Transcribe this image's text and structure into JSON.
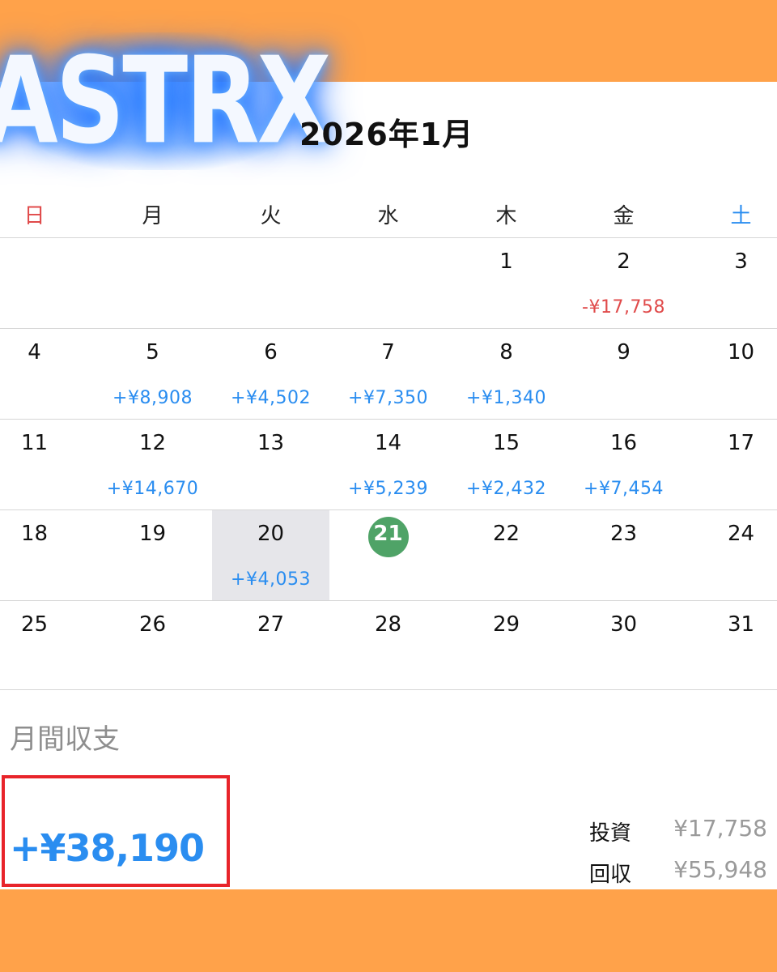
{
  "colors": {
    "banner": "#FFA24A",
    "positive": "#2a8df0",
    "negative": "#e04a4a",
    "today": "#4fa367",
    "highlight_box": "#e8242a"
  },
  "logo_text": "ASTRX",
  "header": {
    "title": "2026年1月"
  },
  "weekdays": [
    "日",
    "月",
    "火",
    "水",
    "木",
    "金",
    "土"
  ],
  "weeks": [
    [
      {
        "day": "",
        "amount": ""
      },
      {
        "day": "",
        "amount": ""
      },
      {
        "day": "",
        "amount": ""
      },
      {
        "day": "",
        "amount": ""
      },
      {
        "day": "1",
        "amount": ""
      },
      {
        "day": "2",
        "amount": "-¥17,758",
        "negative": true
      },
      {
        "day": "3",
        "amount": ""
      }
    ],
    [
      {
        "day": "4",
        "amount": ""
      },
      {
        "day": "5",
        "amount": "+¥8,908"
      },
      {
        "day": "6",
        "amount": "+¥4,502"
      },
      {
        "day": "7",
        "amount": "+¥7,350"
      },
      {
        "day": "8",
        "amount": "+¥1,340"
      },
      {
        "day": "9",
        "amount": ""
      },
      {
        "day": "10",
        "amount": ""
      }
    ],
    [
      {
        "day": "11",
        "amount": ""
      },
      {
        "day": "12",
        "amount": "+¥14,670"
      },
      {
        "day": "13",
        "amount": ""
      },
      {
        "day": "14",
        "amount": "+¥5,239"
      },
      {
        "day": "15",
        "amount": "+¥2,432"
      },
      {
        "day": "16",
        "amount": "+¥7,454"
      },
      {
        "day": "17",
        "amount": ""
      }
    ],
    [
      {
        "day": "18",
        "amount": ""
      },
      {
        "day": "19",
        "amount": ""
      },
      {
        "day": "20",
        "amount": "+¥4,053",
        "selected": true
      },
      {
        "day": "21",
        "amount": "",
        "today": true
      },
      {
        "day": "22",
        "amount": ""
      },
      {
        "day": "23",
        "amount": ""
      },
      {
        "day": "24",
        "amount": ""
      }
    ],
    [
      {
        "day": "25",
        "amount": ""
      },
      {
        "day": "26",
        "amount": ""
      },
      {
        "day": "27",
        "amount": ""
      },
      {
        "day": "28",
        "amount": ""
      },
      {
        "day": "29",
        "amount": ""
      },
      {
        "day": "30",
        "amount": ""
      },
      {
        "day": "31",
        "amount": ""
      }
    ]
  ],
  "summary": {
    "label": "月間収支",
    "total": "+¥38,190",
    "invest_label": "投資",
    "invest_value": "¥17,758",
    "return_label": "回収",
    "return_value": "¥55,948"
  }
}
